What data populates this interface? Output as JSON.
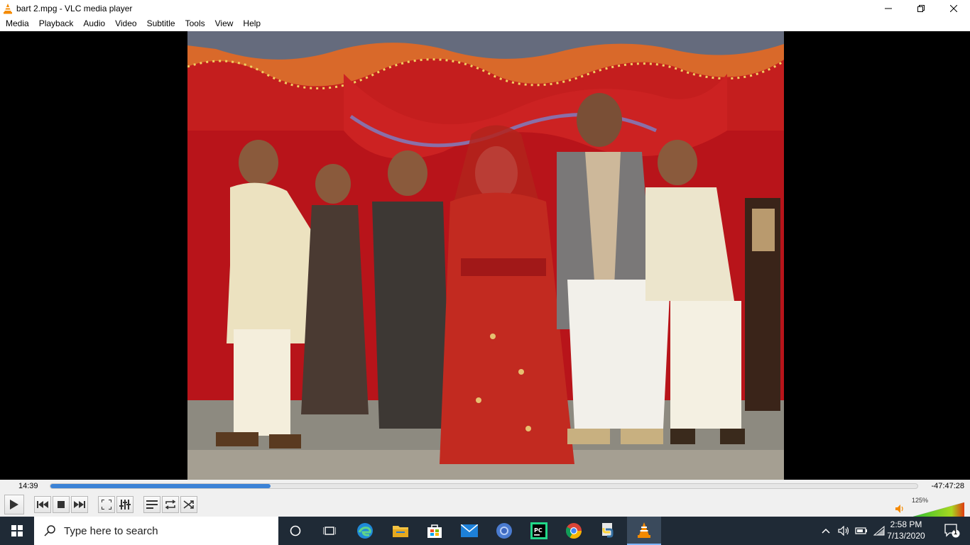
{
  "window": {
    "title": "bart 2.mpg - VLC media player"
  },
  "menu": [
    "Media",
    "Playback",
    "Audio",
    "Video",
    "Subtitle",
    "Tools",
    "View",
    "Help"
  ],
  "playback": {
    "elapsed": "14:39",
    "remaining": "-47:47:28",
    "progress_fraction": 0.254
  },
  "volume": {
    "label": "125%",
    "level_fraction": 1.0
  },
  "taskbar": {
    "search_placeholder": "Type here to search",
    "time": "2:58 PM",
    "date": "7/13/2020",
    "notification_count": "1",
    "pinned_apps": [
      "cortana",
      "task-view",
      "edge",
      "file-explorer",
      "store",
      "mail",
      "chromium",
      "pycharm",
      "chrome",
      "python",
      "vlc"
    ]
  },
  "colors": {
    "seek_fill": "#3b82d6",
    "taskbar_bg": "#1f2a36",
    "vlc_orange": "#f48a00"
  }
}
